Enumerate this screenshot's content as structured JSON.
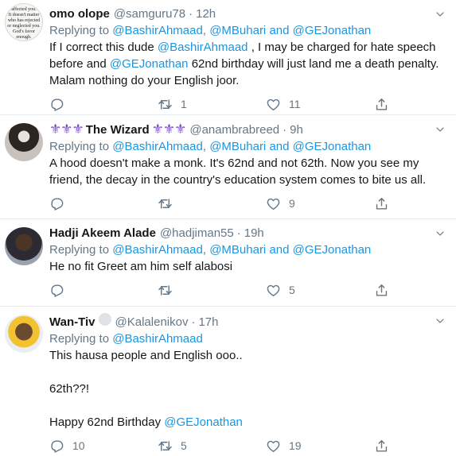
{
  "tweets": [
    {
      "name": "omo olope",
      "handle": "@samguru78",
      "time": "12h",
      "avatar_text": [
        "affected you.",
        "It doesn't matter",
        "who has rejected",
        "or neglected you.",
        "God's favor",
        "enough."
      ],
      "reply_label": "Replying to",
      "reply_mentions": [
        "@BashirAhmaad",
        "@MBuhari",
        "@GEJonathan"
      ],
      "reply_sep_1": ",",
      "reply_sep_2": "and",
      "lines": [
        {
          "pre": "If I correct this dude ",
          "link": "@BashirAhmaad",
          "post": " , I may be charged for hate speech"
        },
        {
          "pre": "before and ",
          "link": "@GEJonathan",
          "post": "  62nd birthday will just land me a death penalty."
        },
        {
          "pre": "Malam nothing do your English joor.",
          "link": "",
          "post": ""
        }
      ],
      "counts": {
        "reply": "",
        "retweet": "1",
        "like": "11"
      }
    },
    {
      "name": "The Wizard",
      "emblem_left": "⚜⚜⚜",
      "emblem_right": "⚜⚜⚜",
      "handle": "@anambrabreed",
      "time": "9h",
      "reply_label": "Replying to",
      "reply_mentions": [
        "@BashirAhmaad",
        "@MBuhari",
        "@GEJonathan"
      ],
      "reply_sep_1": ",",
      "reply_sep_2": "and",
      "lines": [
        {
          "text": "A hood doesn't make a monk. It's 62nd and not 62th. Now you see my"
        },
        {
          "text": "friend, the decay in the country's education system comes to bite us all."
        }
      ],
      "counts": {
        "reply": "",
        "retweet": "",
        "like": "9"
      }
    },
    {
      "name": "Hadji Akeem Alade",
      "handle": "@hadjiman55",
      "time": "19h",
      "reply_label": "Replying to",
      "reply_mentions": [
        "@BashirAhmaad",
        "@MBuhari",
        "@GEJonathan"
      ],
      "reply_sep_1": ",",
      "reply_sep_2": "and",
      "lines": [
        {
          "text": "He no fit Greet am him self alabosi"
        }
      ],
      "counts": {
        "reply": "",
        "retweet": "",
        "like": "5"
      }
    },
    {
      "name": "Wan-Tiv",
      "handle": "@Kalalenikov",
      "time": "17h",
      "reply_label": "Replying to",
      "reply_mentions": [
        "@BashirAhmaad"
      ],
      "lines": [
        {
          "text": "This hausa people and English ooo.."
        },
        {
          "text": "62th??!"
        },
        {
          "pre": "Happy 62nd Birthday ",
          "link": "@GEJonathan"
        }
      ],
      "counts": {
        "reply": "10",
        "retweet": "5",
        "like": "19"
      }
    }
  ],
  "separator": "·",
  "colors": {
    "link": "#1b95e0",
    "muted": "#657786",
    "emblem": "#794bc4"
  },
  "icons": [
    "reply-icon",
    "retweet-icon",
    "like-icon",
    "share-icon",
    "caret-down-icon"
  ]
}
